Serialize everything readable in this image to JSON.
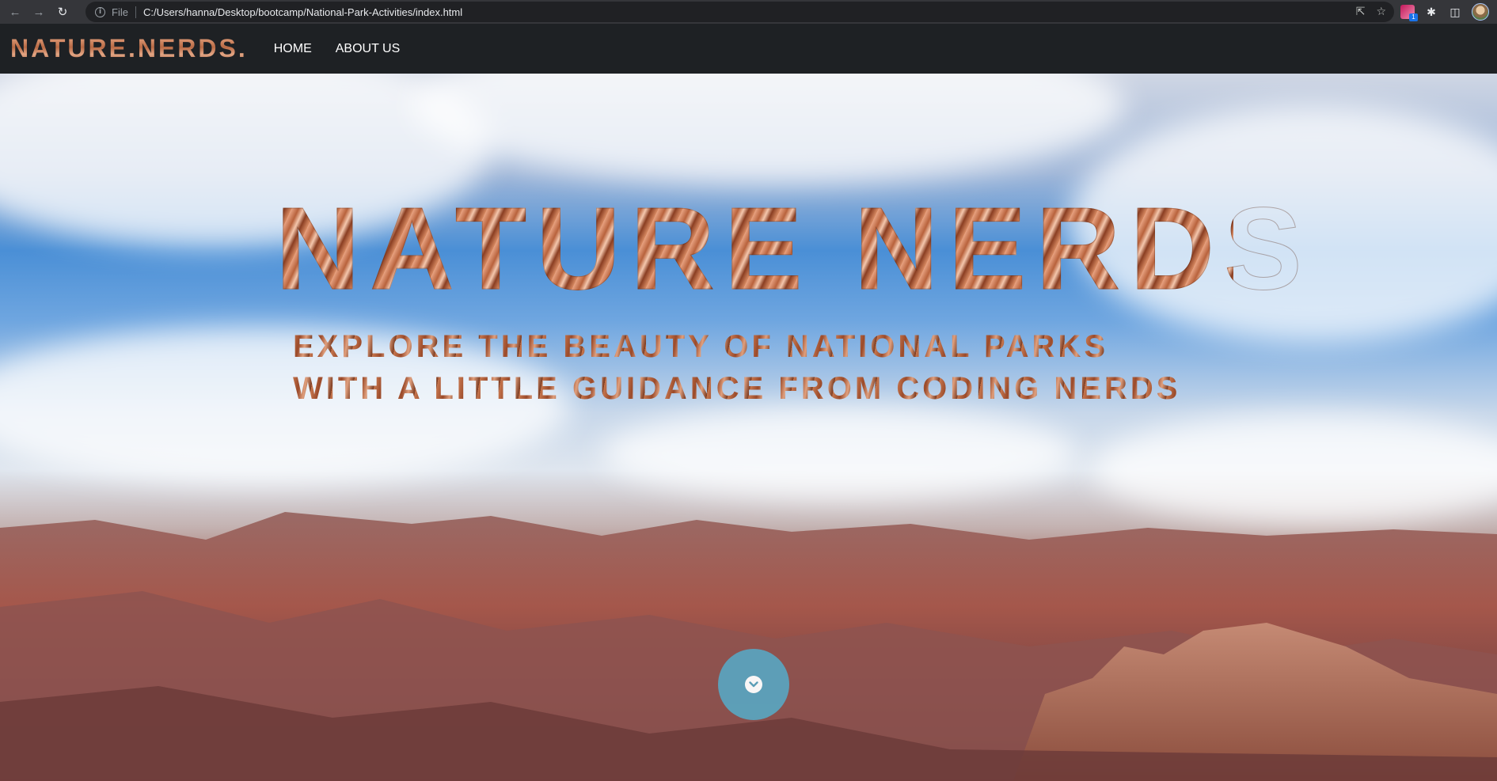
{
  "browser": {
    "scheme_label": "File",
    "url": "C:/Users/hanna/Desktop/bootcamp/National-Park-Activities/index.html",
    "extension_badge": "1"
  },
  "site_nav": {
    "brand": "NATURE.NERDS.",
    "links": [
      {
        "label": "HOME"
      },
      {
        "label": "ABOUT US"
      }
    ]
  },
  "hero": {
    "title": "NATURE NERDS",
    "subtitle_line1": "EXPLORE THE BEAUTY OF NATIONAL PARKS",
    "subtitle_line2": "WITH A LITTLE GUIDANCE FROM CODING NERDS",
    "scroll_icon": "chevron-down-icon"
  },
  "colors": {
    "navbar_bg": "#1e2124",
    "brand_copper": "#b86a45",
    "scroll_button": "#5ba3bd"
  }
}
